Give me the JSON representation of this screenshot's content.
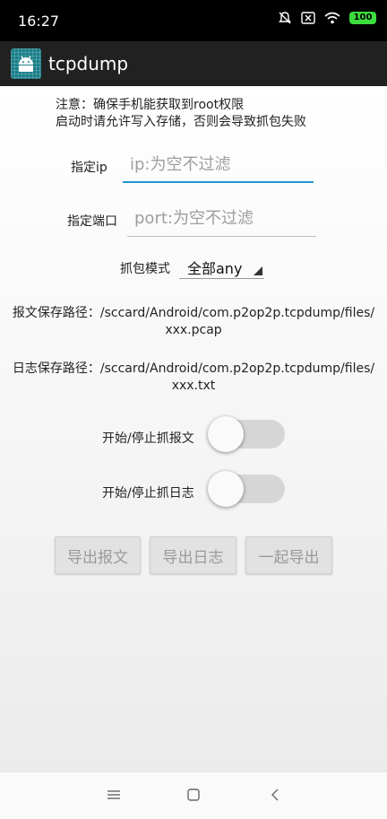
{
  "status_bar": {
    "time": "16:27",
    "battery": "100",
    "icons": [
      "alarm-off-icon",
      "sim-x-icon",
      "wifi-icon",
      "battery-icon"
    ]
  },
  "app_bar": {
    "title": "tcpdump",
    "icon": "android-icon"
  },
  "notice": {
    "line1": "注意：确保手机能获取到root权限",
    "line2": "启动时请允许写入存储，否则会导致抓包失败"
  },
  "ip_field": {
    "label": "指定ip",
    "value": "",
    "placeholder": "ip:为空不过滤"
  },
  "port_field": {
    "label": "指定端口",
    "value": "",
    "placeholder": "port:为空不过滤"
  },
  "capture_mode": {
    "label": "抓包模式",
    "selected": "全部any"
  },
  "packet_path": {
    "line1": "报文保存路径：/sccard/Android/com.p2op2p.tcpdump/files/",
    "line2": "xxx.pcap"
  },
  "log_path": {
    "line1": "日志保存路径：/sccard/Android/com.p2op2p.tcpdump/files/",
    "line2": "xxx.txt"
  },
  "toggles": {
    "packet": {
      "label": "开始/停止抓报文",
      "on": false
    },
    "log": {
      "label": "开始/停止抓日志",
      "on": false
    }
  },
  "buttons": {
    "export_packet": "导出报文",
    "export_log": "导出日志",
    "export_all": "一起导出"
  },
  "nav_bar": {
    "icons": [
      "menu-icon",
      "home-icon",
      "back-icon"
    ]
  },
  "colors": {
    "status_bar": "#000000",
    "app_bar": "#212121",
    "accent": "#2196c9",
    "battery": "#3ddc3d"
  }
}
